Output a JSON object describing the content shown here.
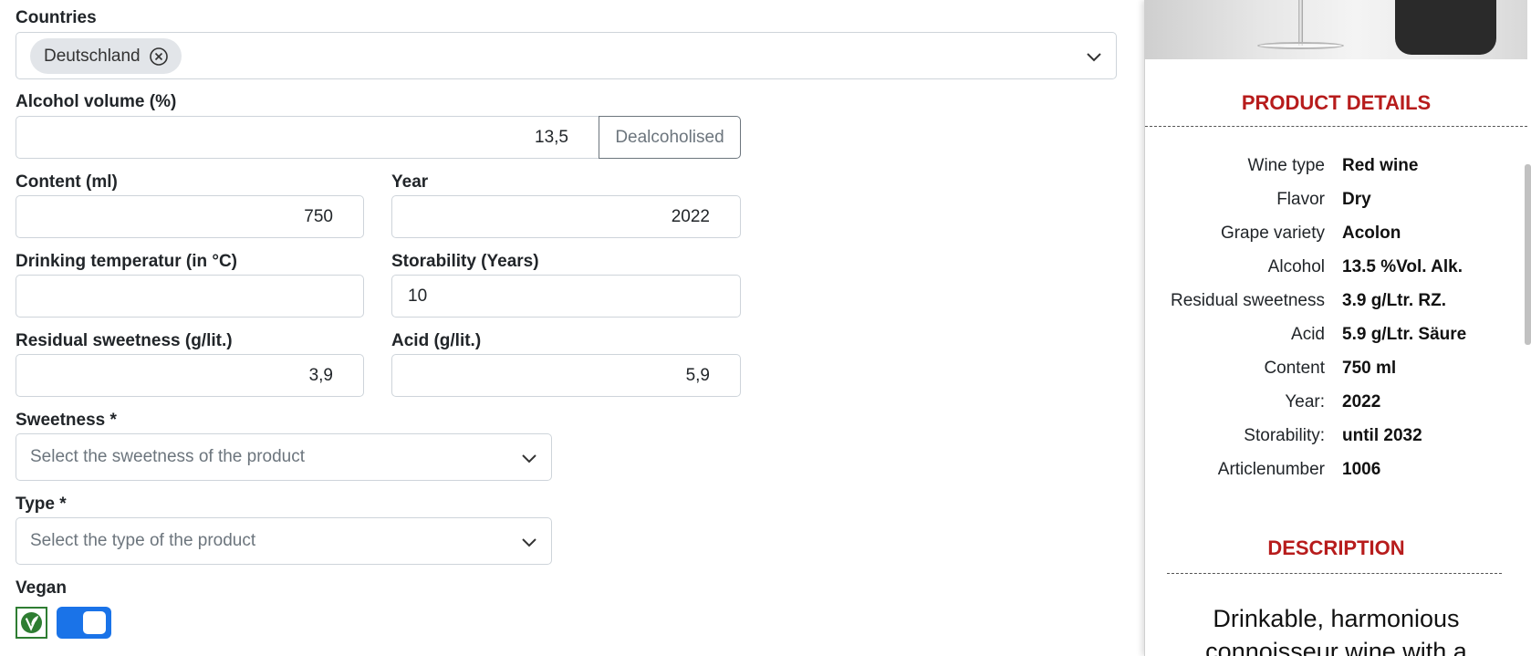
{
  "form": {
    "countries": {
      "label": "Countries",
      "chips": [
        "Deutschland"
      ]
    },
    "alcohol": {
      "label": "Alcohol volume (%)",
      "value": "13,5",
      "button": "Dealcoholised"
    },
    "content": {
      "label": "Content (ml)",
      "value": "750"
    },
    "year": {
      "label": "Year",
      "value": "2022"
    },
    "drinking_temp": {
      "label": "Drinking temperatur (in °C)",
      "value": ""
    },
    "storability": {
      "label": "Storability (Years)",
      "value": "10"
    },
    "residual_sweetness": {
      "label": "Residual sweetness (g/lit.)",
      "value": "3,9"
    },
    "acid": {
      "label": "Acid (g/lit.)",
      "value": "5,9"
    },
    "sweetness": {
      "label": "Sweetness *",
      "placeholder": "Select the sweetness of the product"
    },
    "type": {
      "label": "Type *",
      "placeholder": "Select the type of the product"
    },
    "vegan": {
      "label": "Vegan",
      "enabled": true
    }
  },
  "panel": {
    "details_title": "PRODUCT DETAILS",
    "details": [
      {
        "key": "Wine type",
        "value": "Red wine"
      },
      {
        "key": "Flavor",
        "value": "Dry"
      },
      {
        "key": "Grape variety",
        "value": "Acolon"
      },
      {
        "key": "Alcohol",
        "value": "13.5 %Vol. Alk."
      },
      {
        "key": "Residual sweetness",
        "value": "3.9 g/Ltr. RZ."
      },
      {
        "key": "Acid",
        "value": "5.9 g/Ltr. Säure"
      },
      {
        "key": "Content",
        "value": "750 ml"
      },
      {
        "key": "Year:",
        "value": "2022"
      },
      {
        "key": "Storability:",
        "value": "until 2032"
      },
      {
        "key": "Articlenumber",
        "value": "1006"
      }
    ],
    "description_title": "DESCRIPTION",
    "description_lines": [
      "Drinkable, harmonious",
      "connoisseur wine with a"
    ]
  },
  "colors": {
    "accent_title": "#b71c1c",
    "toggle_on": "#1a73e8",
    "vegan_green": "#2e7d32"
  },
  "icons": [
    "remove-chip-icon",
    "chevron-down-icon",
    "vegan-icon"
  ]
}
